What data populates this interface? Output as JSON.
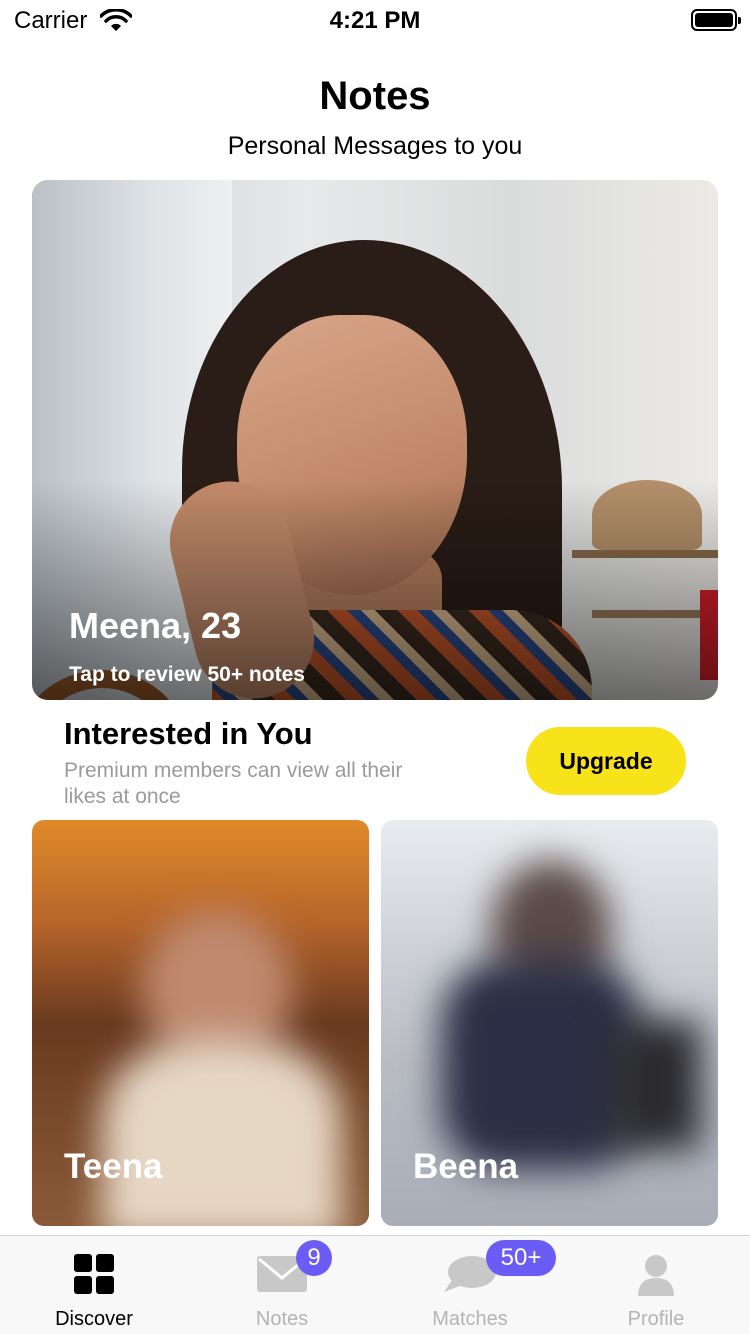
{
  "status_bar": {
    "carrier": "Carrier",
    "time": "4:21 PM"
  },
  "header": {
    "title": "Notes",
    "subtitle": "Personal Messages to you"
  },
  "featured": {
    "name": "Meena, 23",
    "subtitle": "Tap to review 50+ notes"
  },
  "interested": {
    "title": "Interested in You",
    "description": "Premium members can view all their likes at once",
    "upgrade_label": "Upgrade"
  },
  "likes": [
    {
      "name": "Teena"
    },
    {
      "name": "Beena"
    }
  ],
  "tabs": [
    {
      "label": "Discover",
      "icon": "grid-icon",
      "active": true
    },
    {
      "label": "Notes",
      "icon": "envelope-icon",
      "badge": "9"
    },
    {
      "label": "Matches",
      "icon": "chat-bubble-icon",
      "badge": "50+"
    },
    {
      "label": "Profile",
      "icon": "person-icon"
    }
  ],
  "colors": {
    "accent_yellow": "#f8e21a",
    "badge_purple": "#6b5cf6",
    "muted_text": "#9a9a9a"
  }
}
